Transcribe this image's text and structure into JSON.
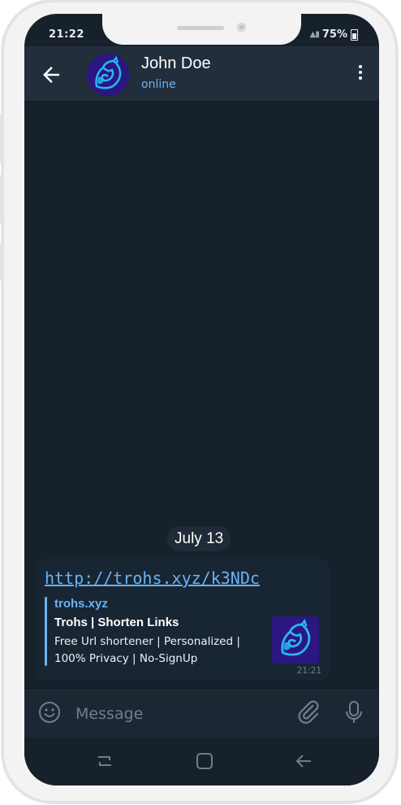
{
  "status_bar": {
    "time": "21:22",
    "battery": "75%"
  },
  "header": {
    "contact_name": "John Doe",
    "contact_status": "online"
  },
  "chat": {
    "date_divider": "July 13",
    "message": {
      "link_text": "http://trohs.xyz/k3NDc",
      "preview": {
        "site": "trohs.xyz",
        "title": "Trohs | Shorten Links",
        "description": "Free Url shortener | Personalized | 100% Privacy | No-SignUp"
      },
      "time": "21:21"
    }
  },
  "composer": {
    "placeholder": "Message"
  },
  "colors": {
    "chat_background": "#17212b",
    "header_background": "#232e3c",
    "bubble_background": "#182533",
    "accent_blue": "#6ab3f3",
    "avatar_purple": "#2a1780",
    "logo_cyan": "#29b6f6"
  },
  "icons": [
    "back-arrow-icon",
    "more-vert-icon",
    "emoji-icon",
    "attach-icon",
    "mic-icon",
    "recents-icon",
    "home-icon",
    "nav-back-icon"
  ]
}
